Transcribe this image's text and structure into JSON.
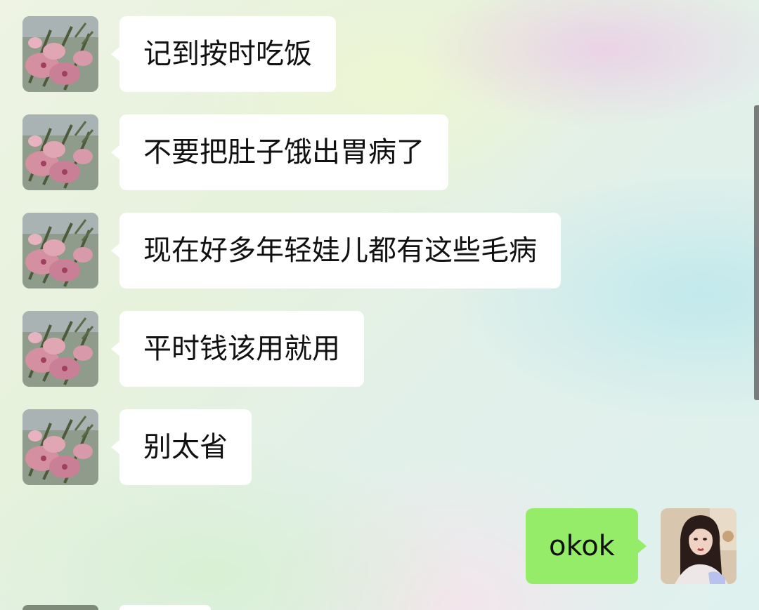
{
  "chat": {
    "messages": [
      {
        "sender": "other",
        "text": "记到按时吃饭"
      },
      {
        "sender": "other",
        "text": "不要把肚子饿出胃病了"
      },
      {
        "sender": "other",
        "text": "现在好多年轻娃儿都有这些毛病"
      },
      {
        "sender": "other",
        "text": "平时钱该用就用"
      },
      {
        "sender": "other",
        "text": "别太省"
      },
      {
        "sender": "self",
        "text": "okok"
      }
    ]
  },
  "avatars": {
    "other": "peach-blossom-photo",
    "self": "woman-portrait-photo"
  },
  "colors": {
    "incoming_bubble": "#ffffff",
    "outgoing_bubble": "#95ec69",
    "text": "#111111"
  }
}
